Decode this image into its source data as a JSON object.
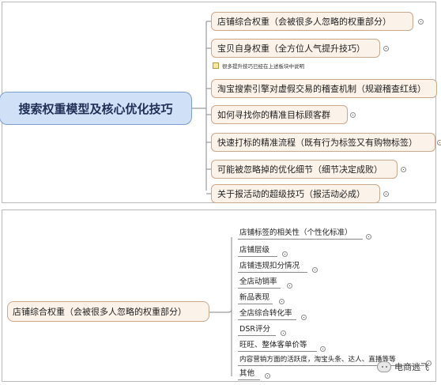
{
  "map1": {
    "root": "搜索权重模型及核心优化技巧",
    "branches": [
      "店铺综合权重（会被很多人忽略的权重部分）",
      "宝贝自身权重（全方位人气提升技巧）",
      "淘宝搜索引擎对虚假交易的稽查机制（规避稽查红线）",
      "如何寻找你的精准目标顾客群",
      "快速打标的精准流程（既有行为标签又有购物标签）",
      "可能被忽略掉的优化细节（细节决定成败）",
      "关于报活动的超级技巧（报活动必成）"
    ],
    "note": "很多提升技巧已经在上述板块中说明"
  },
  "map2": {
    "root": "店铺综合权重（会被很多人忽略的权重部分）",
    "branches": [
      "店铺标签的相关性（个性化标准）",
      "店铺层级",
      "店铺违规扣分情况",
      "全店动销率",
      "新品表现",
      "全店综合转化率",
      "DSR评分",
      "旺旺、整体客单价等",
      "内容营销方面的活跃度，淘宝头条、达人、直播等等",
      "其他"
    ]
  },
  "watermark": "电商逃飞",
  "colors": {
    "root_fill": "#cfe0f7",
    "node_fill": "#fbf2e9",
    "node_border": "#c9a88e",
    "line": "#9a9a9a"
  }
}
